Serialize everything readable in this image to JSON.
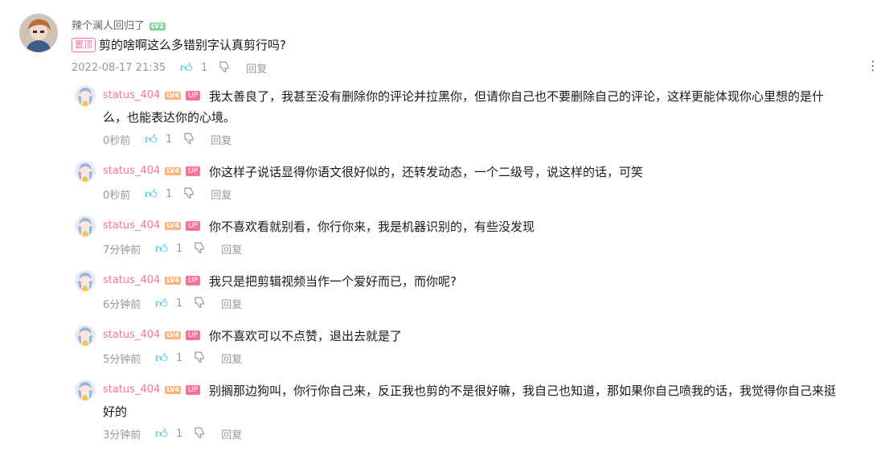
{
  "main_comment": {
    "username": "辣个澜人回归了",
    "level": "LV2",
    "pin_tag": "置顶",
    "text": "剪的啥啊这么多错别字认真剪行吗?",
    "time": "2022-08-17 21:35",
    "likes": "1",
    "reply_label": "回复",
    "more_icon": "more-vertical-icon"
  },
  "replies": [
    {
      "username": "status_404",
      "level": "LV4",
      "up_badge": "UP",
      "text_line1": "我太善良了，我甚至没有删除你的评论并拉黑你，但请你自己也不要删除自己的评论，这样更能体现你心里想的是什",
      "text_line2": "么，也能表达你的心境。",
      "time": "0秒前",
      "likes": "1",
      "reply_label": "回复"
    },
    {
      "username": "status_404",
      "level": "LV4",
      "up_badge": "UP",
      "text_line1": "你这样子说话显得你语文很好似的，还转发动态，一个二级号，说这样的话，可笑",
      "time": "0秒前",
      "likes": "1",
      "reply_label": "回复"
    },
    {
      "username": "status_404",
      "level": "LV4",
      "up_badge": "UP",
      "text_line1": "你不喜欢看就别看，你行你来，我是机器识别的，有些没发现",
      "time": "7分钟前",
      "likes": "1",
      "reply_label": "回复"
    },
    {
      "username": "status_404",
      "level": "LV4",
      "up_badge": "UP",
      "text_line1": "我只是把剪辑视频当作一个爱好而已，而你呢?",
      "time": "6分钟前",
      "likes": "1",
      "reply_label": "回复"
    },
    {
      "username": "status_404",
      "level": "LV4",
      "up_badge": "UP",
      "text_line1": "你不喜欢可以不点赞，退出去就是了",
      "time": "5分钟前",
      "likes": "1",
      "reply_label": "回复"
    },
    {
      "username": "status_404",
      "level": "LV4",
      "up_badge": "UP",
      "text_line1": "别搁那边狗叫，你行你自己来，反正我也剪的不是很好嘛，我自己也知道，那如果你自己喷我的话，我觉得你自己来挺",
      "text_line2": "好的",
      "time": "3分钟前",
      "likes": "1",
      "reply_label": "回复"
    }
  ],
  "colors": {
    "up_pink": "#fb7299",
    "like_blue": "#00aeec",
    "meta_gray": "#9499a0"
  }
}
